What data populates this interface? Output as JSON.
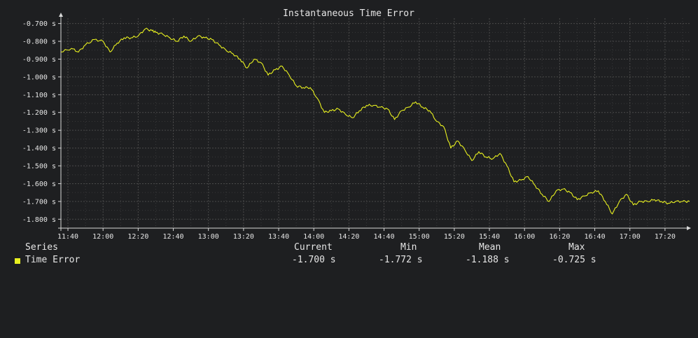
{
  "colors": {
    "background": "#1e1f21",
    "grid": "#4a4a4a",
    "axis": "#d8d8d8",
    "text": "#e6e6e6",
    "series": "#e8f020"
  },
  "legend": {
    "header": {
      "series": "Series",
      "current": "Current",
      "min": "Min",
      "mean": "Mean",
      "max": "Max"
    },
    "rows": [
      {
        "name": "Time Error",
        "current": "-1.700 s",
        "min": "-1.772 s",
        "mean": "-1.188 s",
        "max": "-0.725 s"
      }
    ]
  },
  "chart_data": {
    "type": "line",
    "title": "Instantaneous Time Error",
    "xlabel": "",
    "ylabel": "",
    "grid": true,
    "x_unit": "minutes since midnight",
    "xlim": [
      "11:36",
      "17:34"
    ],
    "ylim": [
      -1.85,
      -0.67
    ],
    "x_ticks": [
      "11:40",
      "12:00",
      "12:20",
      "12:40",
      "13:00",
      "13:20",
      "13:40",
      "14:00",
      "14:20",
      "14:40",
      "15:00",
      "15:20",
      "15:40",
      "16:00",
      "16:20",
      "16:40",
      "17:00",
      "17:20"
    ],
    "y_ticks": [
      "-0.700 s",
      "-0.800 s",
      "-0.900 s",
      "-1.000 s",
      "-1.100 s",
      "-1.200 s",
      "-1.300 s",
      "-1.400 s",
      "-1.500 s",
      "-1.600 s",
      "-1.700 s",
      "-1.800 s"
    ],
    "y_tick_values": [
      -0.7,
      -0.8,
      -0.9,
      -1.0,
      -1.1,
      -1.2,
      -1.3,
      -1.4,
      -1.5,
      -1.6,
      -1.7,
      -1.8
    ],
    "series": [
      {
        "name": "Time Error",
        "x": [
          "11:36",
          "11:42",
          "11:46",
          "11:50",
          "11:55",
          "12:00",
          "12:04",
          "12:08",
          "12:12",
          "12:16",
          "12:20",
          "12:24",
          "12:28",
          "12:30",
          "12:34",
          "12:38",
          "12:42",
          "12:46",
          "12:50",
          "12:54",
          "12:58",
          "13:02",
          "13:06",
          "13:10",
          "13:14",
          "13:18",
          "13:22",
          "13:26",
          "13:30",
          "13:34",
          "13:38",
          "13:42",
          "13:46",
          "13:50",
          "13:54",
          "13:58",
          "14:02",
          "14:06",
          "14:10",
          "14:14",
          "14:18",
          "14:22",
          "14:26",
          "14:30",
          "14:34",
          "14:38",
          "14:42",
          "14:46",
          "14:50",
          "14:54",
          "14:58",
          "15:02",
          "15:06",
          "15:10",
          "15:14",
          "15:18",
          "15:22",
          "15:26",
          "15:30",
          "15:34",
          "15:38",
          "15:42",
          "15:46",
          "15:50",
          "15:54",
          "15:58",
          "16:02",
          "16:06",
          "16:10",
          "16:14",
          "16:18",
          "16:22",
          "16:26",
          "16:30",
          "16:34",
          "16:38",
          "16:42",
          "16:46",
          "16:50",
          "16:54",
          "16:58",
          "17:02",
          "17:06",
          "17:10",
          "17:14",
          "17:18",
          "17:22",
          "17:26",
          "17:30",
          "17:34"
        ],
        "y": [
          -0.86,
          -0.84,
          -0.86,
          -0.82,
          -0.79,
          -0.8,
          -0.86,
          -0.81,
          -0.78,
          -0.78,
          -0.77,
          -0.73,
          -0.74,
          -0.75,
          -0.76,
          -0.78,
          -0.8,
          -0.77,
          -0.8,
          -0.77,
          -0.78,
          -0.79,
          -0.82,
          -0.85,
          -0.87,
          -0.9,
          -0.95,
          -0.9,
          -0.92,
          -0.99,
          -0.96,
          -0.94,
          -0.99,
          -1.05,
          -1.06,
          -1.06,
          -1.12,
          -1.2,
          -1.19,
          -1.18,
          -1.21,
          -1.23,
          -1.19,
          -1.16,
          -1.16,
          -1.17,
          -1.18,
          -1.24,
          -1.19,
          -1.17,
          -1.14,
          -1.17,
          -1.19,
          -1.25,
          -1.28,
          -1.4,
          -1.36,
          -1.41,
          -1.47,
          -1.42,
          -1.45,
          -1.46,
          -1.43,
          -1.5,
          -1.59,
          -1.58,
          -1.56,
          -1.61,
          -1.66,
          -1.7,
          -1.64,
          -1.63,
          -1.65,
          -1.69,
          -1.67,
          -1.65,
          -1.64,
          -1.7,
          -1.77,
          -1.7,
          -1.66,
          -1.72,
          -1.7,
          -1.7,
          -1.69,
          -1.7,
          -1.71,
          -1.7,
          -1.7,
          -1.7
        ]
      }
    ]
  }
}
